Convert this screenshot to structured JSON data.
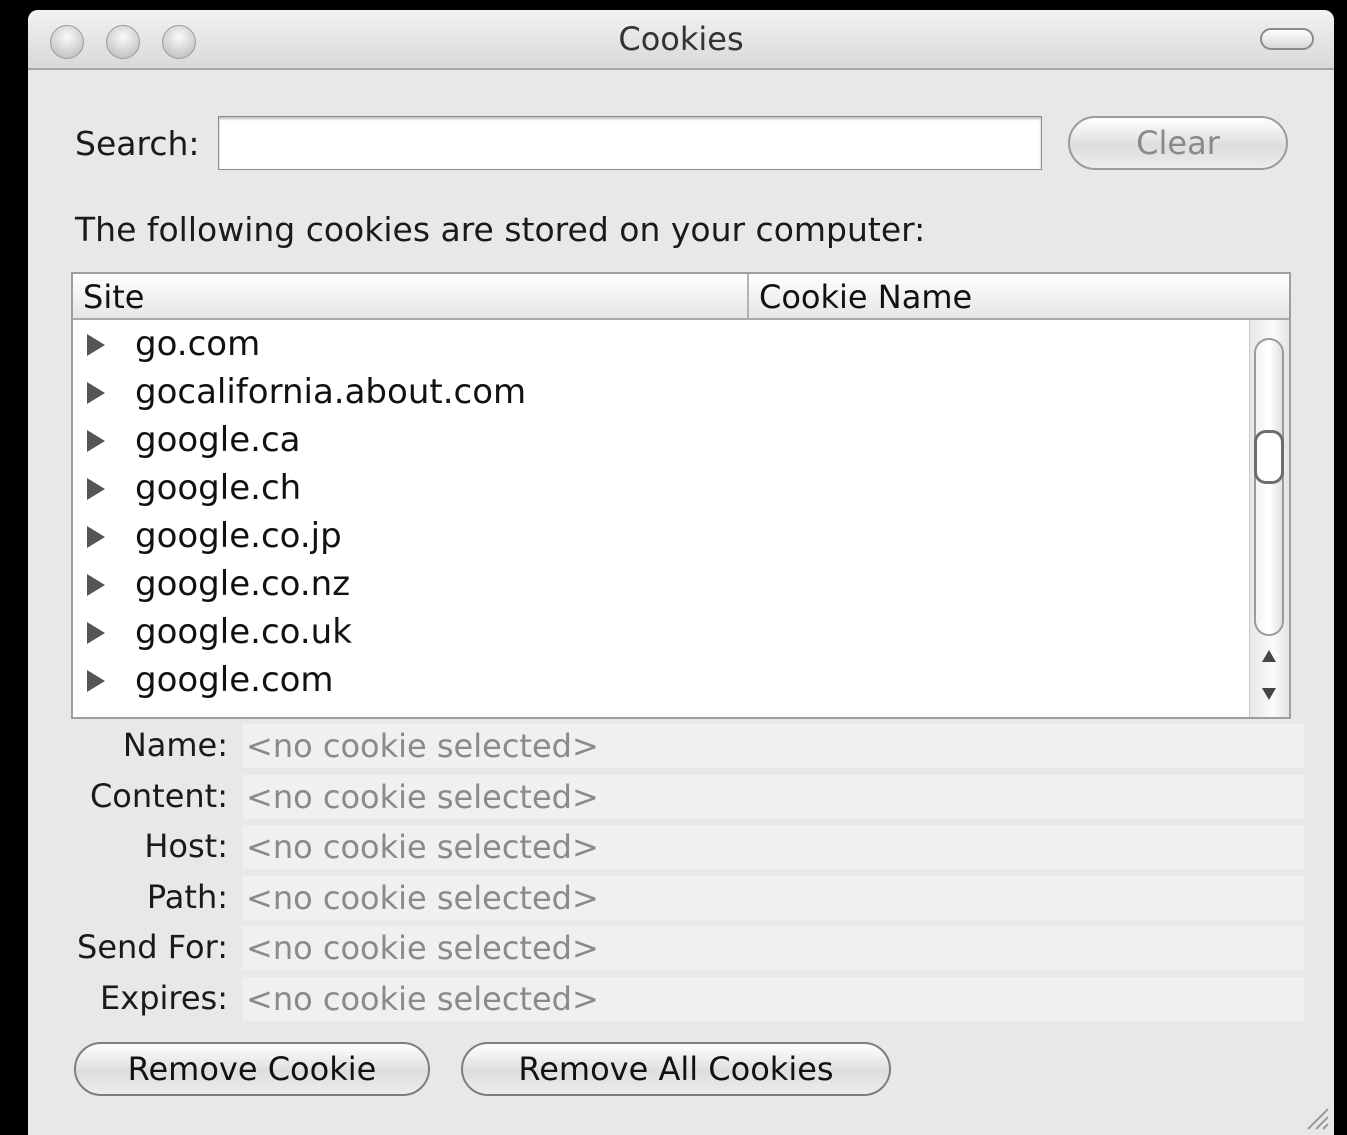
{
  "window": {
    "title": "Cookies"
  },
  "search": {
    "label": "Search:",
    "value": "",
    "placeholder": "",
    "clear_label": "Clear"
  },
  "description": "The following cookies are stored on your computer:",
  "table": {
    "columns": [
      "Site",
      "Cookie Name"
    ],
    "rows": [
      "go.com",
      "gocalifornia.about.com",
      "google.ca",
      "google.ch",
      "google.co.jp",
      "google.co.nz",
      "google.co.uk",
      "google.com"
    ]
  },
  "details": [
    {
      "label": "Name:",
      "value": "<no cookie selected>"
    },
    {
      "label": "Content:",
      "value": "<no cookie selected>"
    },
    {
      "label": "Host:",
      "value": "<no cookie selected>"
    },
    {
      "label": "Path:",
      "value": "<no cookie selected>"
    },
    {
      "label": "Send For:",
      "value": "<no cookie selected>"
    },
    {
      "label": "Expires:",
      "value": "<no cookie selected>"
    }
  ],
  "buttons": {
    "remove_cookie": "Remove Cookie",
    "remove_all": "Remove All Cookies"
  }
}
